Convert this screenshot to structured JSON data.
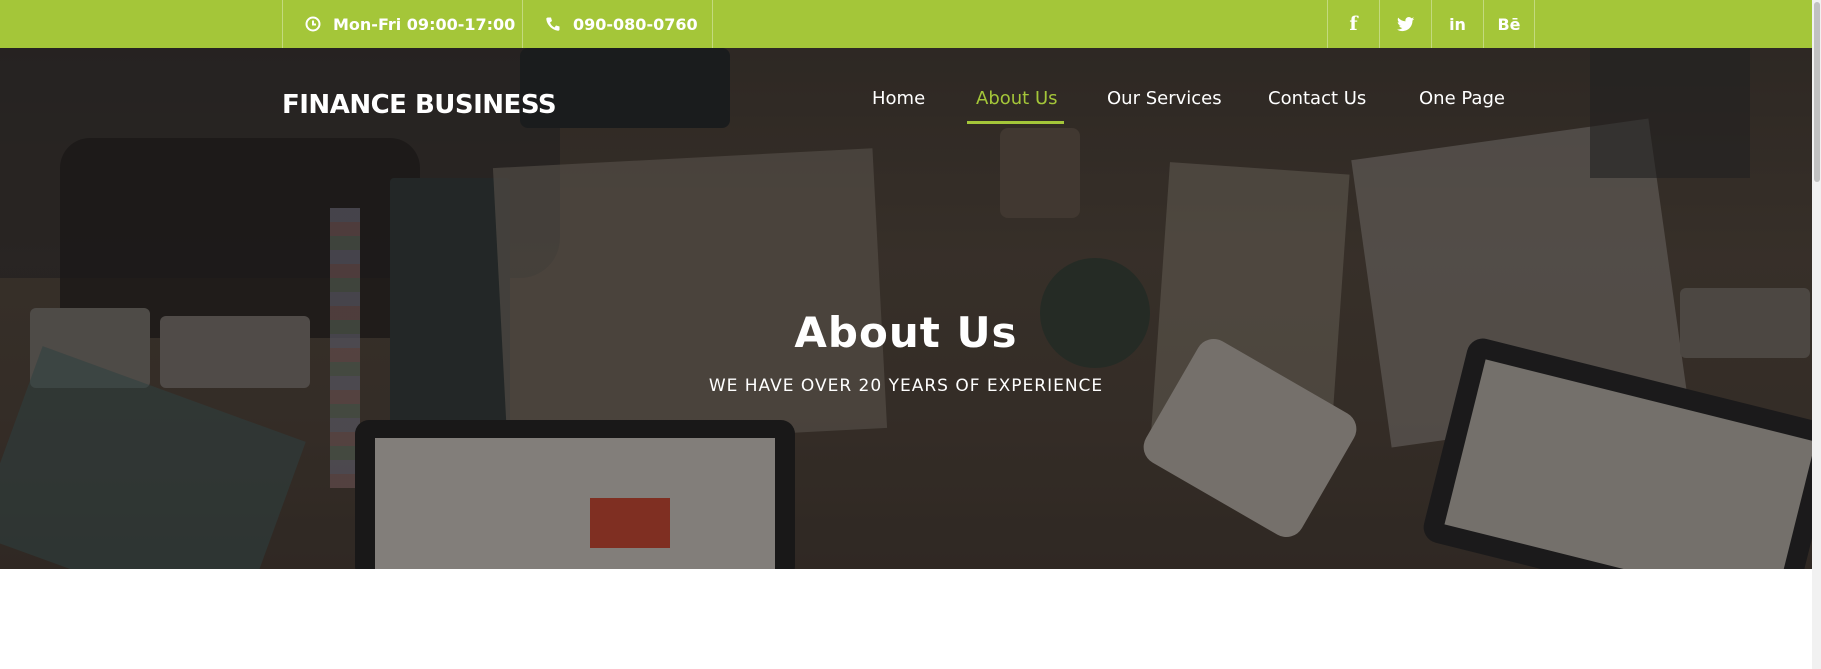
{
  "topbar": {
    "hours": "Mon-Fri 09:00-17:00",
    "phone": "090-080-0760",
    "social": [
      {
        "icon": "facebook-icon",
        "glyph": "f"
      },
      {
        "icon": "twitter-icon",
        "glyph": "🐦"
      },
      {
        "icon": "linkedin-icon",
        "glyph": "in"
      },
      {
        "icon": "behance-icon",
        "glyph": "Bē"
      }
    ],
    "color": "#a4c639"
  },
  "header": {
    "brand": "FINANCE BUSINESS",
    "nav": [
      {
        "label": "Home",
        "active": false
      },
      {
        "label": "About Us",
        "active": true
      },
      {
        "label": "Our Services",
        "active": false
      },
      {
        "label": "Contact Us",
        "active": false
      },
      {
        "label": "One Page",
        "active": false
      }
    ]
  },
  "hero": {
    "title": "About Us",
    "subtitle": "WE HAVE OVER 20 YEARS OF EXPERIENCE"
  },
  "colors": {
    "accent": "#a4c639",
    "text_light": "#ffffff"
  }
}
